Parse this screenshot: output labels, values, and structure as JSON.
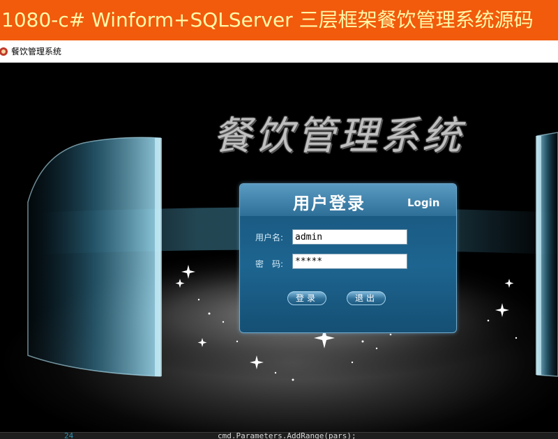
{
  "banner": {
    "text": "1080-c# Winform+SQLServer 三层框架餐饮管理系统源码"
  },
  "window": {
    "title": "餐饮管理系统"
  },
  "stage": {
    "title": "餐饮管理系统"
  },
  "login": {
    "title": "用户登录",
    "subtitle": "Login",
    "username_label": "用户名:",
    "username_value": "admin",
    "password_label": "密　码:",
    "password_value": "*****",
    "login_button": "登录",
    "exit_button": "退出"
  },
  "code_strip": {
    "line_number": "24",
    "text": "cmd.Parameters.AddRange(pars);"
  },
  "colors": {
    "banner_bg": "#f25a0c",
    "banner_text": "#fff9a8",
    "panel_blue": "#1d6590"
  }
}
